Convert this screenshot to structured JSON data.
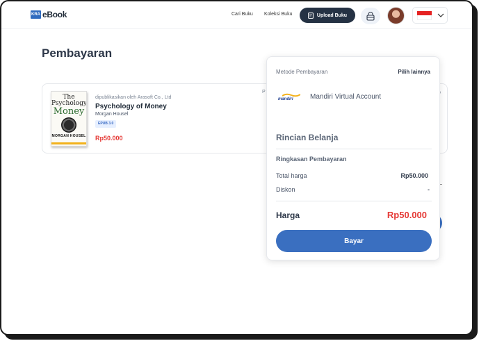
{
  "header": {
    "logo_mark": "KRA",
    "logo_text": "eBook",
    "nav": [
      "Cari Buku",
      "Koleksi Buku"
    ],
    "upload_label": "Upload Buku"
  },
  "page": {
    "title": "Pembayaran"
  },
  "cart": {
    "publisher": "dipublikasikan oleh Arasoft Co., Ltd",
    "title": "Psychology of Money",
    "author": "Morgan Housel",
    "format": "EPUB 3.0",
    "price": "Rp50.000",
    "cover": {
      "line1": "The",
      "line2": "Psychology",
      "line3": "Money",
      "author": "MORGAN HOUSEL"
    },
    "partial_left": "P",
    "partial_right": "b"
  },
  "panel": {
    "method_label": "Metode Pembayaran",
    "other_label": "Pilih lainnya",
    "bank_logo": "mandiri",
    "bank_name": "Mandiri Virtual Account",
    "section_title": "Rincian Belanja",
    "summary_title": "Ringkasan Pembayaran",
    "rows": [
      {
        "label": "Total harga",
        "value": "Rp50.000"
      },
      {
        "label": "Diskon",
        "value": "-"
      }
    ],
    "total_label": "Harga",
    "total_value": "Rp50.000",
    "pay_label": "Bayar"
  },
  "colors": {
    "accent": "#3a6fc0",
    "price": "#e53935",
    "dark": "#253244"
  },
  "icons": {
    "upload": "book-icon",
    "cart": "shopping-bag-icon",
    "lang": "chevron-down-icon"
  }
}
